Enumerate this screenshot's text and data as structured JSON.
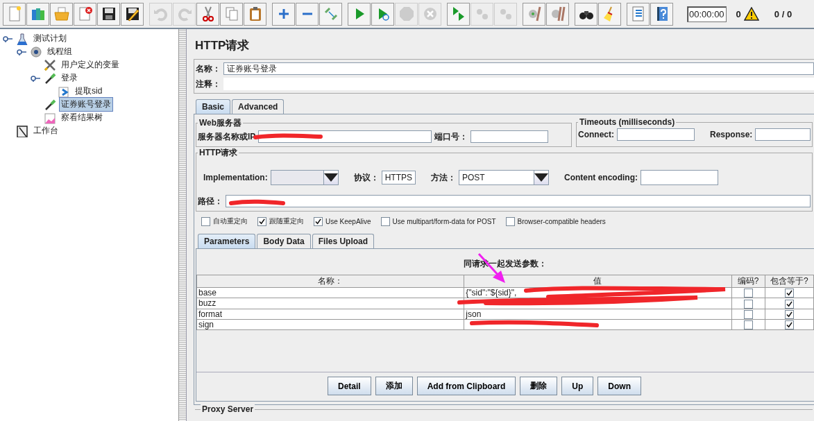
{
  "toolbar": {
    "groups": [
      [
        {
          "disabled": false
        },
        {
          "disabled": false
        },
        {
          "disabled": false
        },
        {
          "disabled": false
        },
        {
          "disabled": false
        },
        {
          "disabled": false
        }
      ],
      [
        {
          "disabled": true
        },
        {
          "disabled": true
        },
        {
          "disabled": false
        },
        {
          "disabled": false
        },
        {
          "disabled": false
        }
      ],
      [
        {
          "disabled": false
        },
        {
          "disabled": false
        },
        {
          "disabled": false
        }
      ],
      [
        {
          "disabled": false
        },
        {
          "disabled": false
        },
        {
          "disabled": true
        },
        {
          "disabled": true
        }
      ],
      [
        {
          "disabled": false
        },
        {
          "disabled": true
        },
        {
          "disabled": true
        }
      ],
      [
        {
          "disabled": false
        },
        {
          "disabled": false
        }
      ],
      [
        {
          "disabled": false
        },
        {
          "disabled": false
        }
      ],
      [
        {
          "disabled": false
        },
        {
          "disabled": false
        }
      ]
    ],
    "timer": "00:00:00",
    "warnings": "0",
    "threads": "0 / 0"
  },
  "tree": [
    {
      "label": "测试计划",
      "kind": "plan",
      "selected": false,
      "expanded": true,
      "children": [
        {
          "label": "线程组",
          "kind": "threads",
          "selected": false,
          "expanded": true,
          "children": [
            {
              "label": "用户定义的变量",
              "kind": "vars",
              "selected": false
            },
            {
              "label": "登录",
              "kind": "sampler",
              "selected": false,
              "expanded": true,
              "children": [
                {
                  "label": "提取sid",
                  "kind": "extractor",
                  "selected": false
                }
              ]
            },
            {
              "label": "证券账号登录",
              "kind": "sampler",
              "selected": true
            },
            {
              "label": "察看结果树",
              "kind": "listener",
              "selected": false
            }
          ]
        }
      ]
    },
    {
      "label": "工作台",
      "kind": "workbench",
      "selected": false
    }
  ],
  "panel": {
    "title": "HTTP请求",
    "name_label": "名称：",
    "name_value": "证券账号登录",
    "comment_label": "注释：",
    "tabs": [
      {
        "label": "Basic",
        "selected": true
      },
      {
        "label": "Advanced",
        "selected": false
      }
    ],
    "web_server": {
      "legend": "Web服务器",
      "server_label": "服务器名称或IP",
      "port_label": "端口号："
    },
    "timeouts": {
      "legend": "Timeouts (milliseconds)",
      "connect_label": "Connect:",
      "response_label": "Response:"
    },
    "http_request": {
      "legend": "HTTP请求",
      "implementation_label": "Implementation:",
      "protocol_label": "协议：",
      "protocol_value": "HTTPS",
      "method_label": "方法：",
      "method_value": "POST",
      "encoding_label": "Content encoding:",
      "path_label": "路径："
    },
    "options": [
      {
        "label": "自动重定向",
        "checked": false
      },
      {
        "label": "跟随重定向",
        "checked": true
      },
      {
        "label": "Use KeepAlive",
        "checked": true
      },
      {
        "label": "Use multipart/form-data for POST",
        "checked": false
      },
      {
        "label": "Browser-compatible headers",
        "checked": false
      }
    ],
    "param_tabs": [
      {
        "label": "Parameters",
        "selected": true
      },
      {
        "label": "Body Data",
        "selected": false
      },
      {
        "label": "Files Upload",
        "selected": false
      }
    ],
    "table": {
      "caption": "同请求一起发送参数：",
      "columns": [
        "名称：",
        "值",
        "编码?",
        "包含等于?"
      ],
      "rows": [
        {
          "name": "base",
          "value": "{\"sid\":\"${sid}\",",
          "encode": false,
          "include_equals": true
        },
        {
          "name": "buzz",
          "encode": false,
          "include_equals": true
        },
        {
          "name": "format",
          "value": "json",
          "encode": false,
          "include_equals": true
        },
        {
          "name": "sign",
          "encode": false,
          "include_equals": true
        }
      ]
    },
    "buttons": [
      "Detail",
      "添加",
      "Add from Clipboard",
      "删除",
      "Up",
      "Down"
    ],
    "proxy_legend": "Proxy Server"
  },
  "annotations": [
    {
      "kind": "scribble"
    },
    {
      "kind": "scribble"
    },
    {
      "kind": "scribble"
    },
    {
      "kind": "scribble"
    },
    {
      "kind": "scribble"
    },
    {
      "kind": "arrow"
    }
  ]
}
